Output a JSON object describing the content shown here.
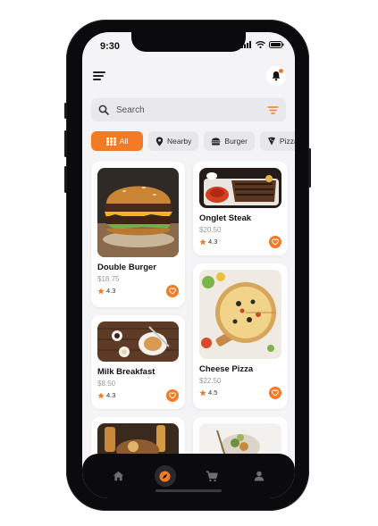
{
  "status": {
    "time": "9:30"
  },
  "search": {
    "placeholder": "Search"
  },
  "filters": [
    {
      "label": "All",
      "icon": "grid-icon",
      "active": true
    },
    {
      "label": "Nearby",
      "icon": "location-pin-icon"
    },
    {
      "label": "Burger",
      "icon": "burger-icon"
    },
    {
      "label": "Pizza",
      "icon": "pizza-icon"
    }
  ],
  "products": [
    {
      "name": "Double Burger",
      "price": "$18.75",
      "rating": "4.3"
    },
    {
      "name": "Onglet Steak",
      "price": "$20.50",
      "rating": "4.3"
    },
    {
      "name": "Milk Breakfast",
      "price": "$8.50",
      "rating": "4.3"
    },
    {
      "name": "Cheese Pizza",
      "price": "$22.50",
      "rating": "4.5"
    }
  ],
  "colors": {
    "accent": "#f47b25",
    "background": "#f4f4f6",
    "nav": "#0b0b0d"
  },
  "nav": [
    {
      "icon": "home-icon"
    },
    {
      "icon": "compass-icon",
      "active": true
    },
    {
      "icon": "cart-icon"
    },
    {
      "icon": "profile-icon"
    }
  ]
}
